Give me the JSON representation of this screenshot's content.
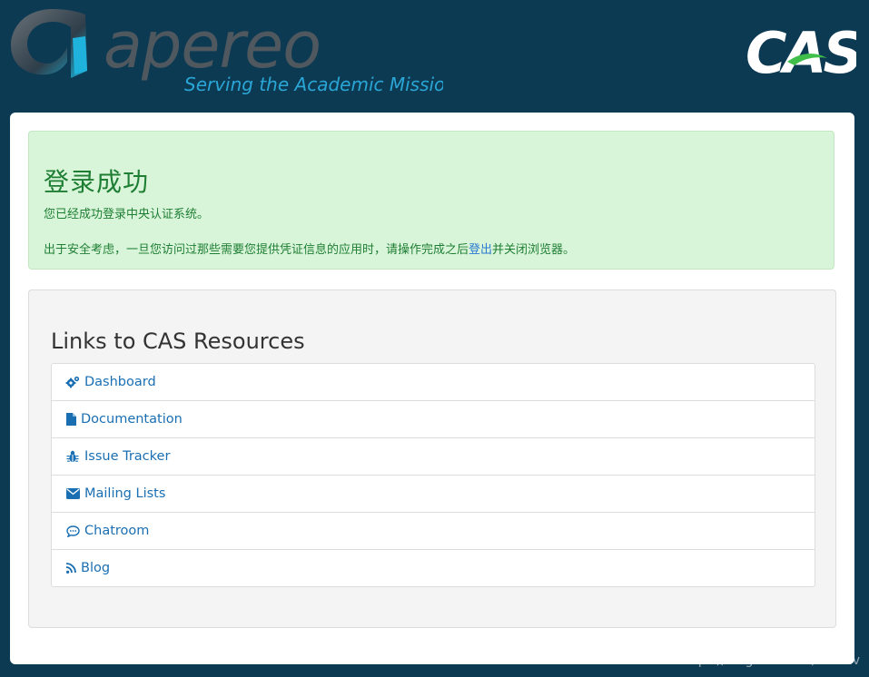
{
  "header": {
    "logo_text": "apereo",
    "tagline": "Serving the Academic Mission",
    "cas_logo_text": "CAS"
  },
  "success": {
    "title": "登录成功",
    "message": "您已经成功登录中央认证系统。",
    "security_prefix": "出于安全考虑，一旦您访问过那些需要您提供凭证信息的应用时，请操作完成之后",
    "logout_link": "登出",
    "security_suffix": "并关闭浏览器。"
  },
  "resources": {
    "title": "Links to CAS Resources",
    "items": [
      {
        "label": "Dashboard",
        "icon": "gears-icon"
      },
      {
        "label": "Documentation",
        "icon": "file-icon"
      },
      {
        "label": "Issue Tracker",
        "icon": "bug-icon"
      },
      {
        "label": "Mailing Lists",
        "icon": "envelope-icon"
      },
      {
        "label": "Chatroom",
        "icon": "chat-bubble-icon"
      },
      {
        "label": "Blog",
        "icon": "rss-icon"
      }
    ]
  },
  "watermark": "https://blog.csdn.net/oumuv",
  "colors": {
    "background": "#0d3a53",
    "success_bg": "#d9f5d9",
    "success_text": "#1e7e34",
    "link": "#1a6fb3"
  }
}
